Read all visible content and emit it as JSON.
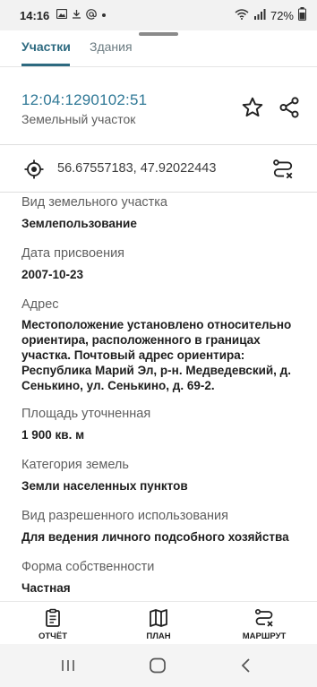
{
  "status_bar": {
    "time": "14:16",
    "battery": "72%"
  },
  "tabs": [
    {
      "label": "Участки",
      "active": true
    },
    {
      "label": "Здания",
      "active": false
    }
  ],
  "header": {
    "cadastral_number": "12:04:1290102:51",
    "object_type": "Земельный участок"
  },
  "coordinates": "56.67557183, 47.92022443",
  "fields": [
    {
      "label": "Вид земельного участка",
      "value": "Землепользование"
    },
    {
      "label": "Дата присвоения",
      "value": "2007-10-23"
    },
    {
      "label": "Адрес",
      "value": "Местоположение установлено относительно ориентира, расположенного в границах участка. Почтовый адрес ориентира: Республика Марий Эл, р-н. Медведевский, д. Сенькино, ул. Сенькино, д. 69-2."
    },
    {
      "label": "Площадь уточненная",
      "value": "1 900 кв. м"
    },
    {
      "label": "Категория земель",
      "value": "Земли населенных пунктов"
    },
    {
      "label": "Вид разрешенного использования",
      "value": "Для ведения личного подсобного хозяйства"
    },
    {
      "label": "Форма собственности",
      "value": "Частная"
    }
  ],
  "bottom_bar": {
    "report_label": "ОТЧЁТ",
    "plan_label": "ПЛАН",
    "route_label": "МАРШРУТ"
  },
  "colors": {
    "accent": "#2d6a80",
    "link": "#2f7896"
  }
}
